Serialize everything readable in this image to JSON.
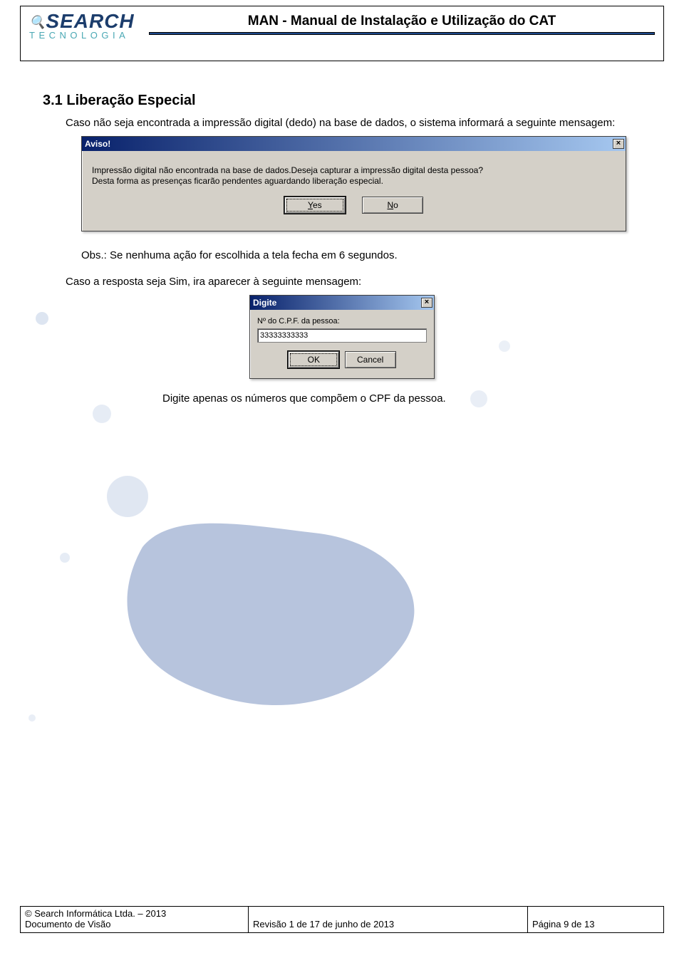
{
  "header": {
    "logo_main": "SEARCH",
    "logo_sub": "TECNOLOGIA",
    "doc_title": "MAN - Manual de Instalação e Utilização do CAT"
  },
  "section": {
    "heading": "3.1 Liberação Especial",
    "intro": "Caso não seja encontrada a impressão digital (dedo) na base de dados, o sistema informará a seguinte mensagem:",
    "note_label": "Obs.: Se nenhuma ação for escolhida a tela fecha em 6 segundos.",
    "after_dialog1": "Caso a resposta seja Sim, ira aparecer à seguinte mensagem:",
    "after_dialog2": "Digite apenas os números que compõem o CPF da pessoa."
  },
  "dialog1": {
    "title": "Aviso!",
    "line1": "Impressão digital não encontrada na base de dados.Deseja capturar a impressão digital desta pessoa?",
    "line2": "Desta forma as presenças ficarão pendentes aguardando liberação especial.",
    "yes_prefix": "Y",
    "yes_suffix": "es",
    "no_prefix": "N",
    "no_suffix": "o"
  },
  "dialog2": {
    "title": "Digite",
    "field_label": "Nº do C.P.F. da pessoa:",
    "field_value": "33333333333",
    "ok": "OK",
    "cancel": "Cancel"
  },
  "footer": {
    "company": "© Search Informática Ltda. – 2013",
    "doc": "Documento de Visão",
    "revision": "Revisão 1 de 17 de junho de 2013",
    "page": "Página 9 de 13"
  }
}
